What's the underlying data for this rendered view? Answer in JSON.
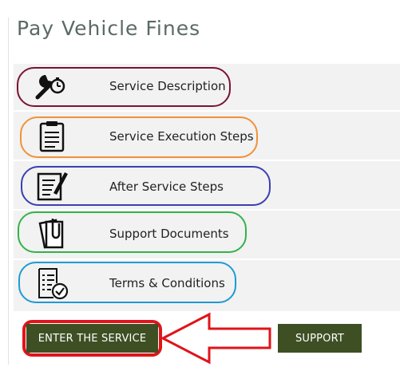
{
  "page": {
    "title": "Pay Vehicle Fines"
  },
  "menu": {
    "items": [
      {
        "label": "Service Description",
        "icon": "wrench-stopwatch-icon",
        "outline_color": "#7a1230"
      },
      {
        "label": "Service Execution Steps",
        "icon": "clipboard-icon",
        "outline_color": "#f0913a"
      },
      {
        "label": "After Service Steps",
        "icon": "notepad-pencil-icon",
        "outline_color": "#3a3fb3"
      },
      {
        "label": "Support Documents",
        "icon": "documents-paperclip-icon",
        "outline_color": "#33b24a"
      },
      {
        "label": "Terms & Conditions",
        "icon": "list-checkmark-icon",
        "outline_color": "#1f9ad6"
      }
    ]
  },
  "actions": {
    "enter_label": "ENTER THE SERVICE",
    "support_label": "SUPPORT"
  },
  "colors": {
    "button_bg": "#3e5023",
    "highlight": "#e0141a",
    "panel_bg": "#f2f2f2"
  }
}
